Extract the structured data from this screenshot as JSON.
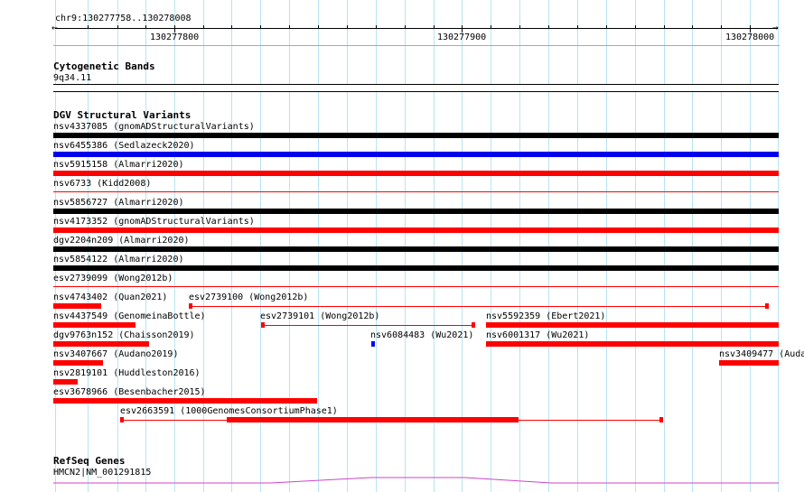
{
  "ruler": {
    "locus": "chr9:130277758..130278008",
    "left_arrow": "←",
    "right_arrow": "→",
    "tick_labels": [
      "130277800",
      "130277900",
      "130278000"
    ]
  },
  "cytoband": {
    "title": "Cytogenetic Bands",
    "band": "9q34.11"
  },
  "dgv": {
    "title": "DGV Structural Variants",
    "variants": [
      {
        "label": "nsv4337085 (gnomADStructuralVariants)",
        "color": "#000000"
      },
      {
        "label": "nsv6455386 (Sedlazeck2020)",
        "color": "#0000ee"
      },
      {
        "label": "nsv5915158 (Almarri2020)",
        "color": "#ff0000"
      },
      {
        "label": "nsv6733 (Kidd2008)",
        "color": "#ff0000"
      },
      {
        "label": "nsv5856727 (Almarri2020)",
        "color": "#000000"
      },
      {
        "label": "nsv4173352 (gnomADStructuralVariants)",
        "color": "#ff0000"
      },
      {
        "label": "dgv2204n209 (Almarri2020)",
        "color": "#000000"
      },
      {
        "label": "nsv5854122 (Almarri2020)",
        "color": "#000000"
      },
      {
        "label": "esv2739099 (Wong2012b)",
        "color": "#ff0000"
      },
      {
        "label": "nsv4743402 (Quan2021)",
        "color": "#ff0000"
      },
      {
        "label": "esv2739100 (Wong2012b)",
        "color": "#ff0000"
      },
      {
        "label": "nsv4437549 (GenomeinaBottle)",
        "color": "#ff0000"
      },
      {
        "label": "esv2739101 (Wong2012b)",
        "color": "#ff0000"
      },
      {
        "label": "nsv5592359 (Ebert2021)",
        "color": "#ff0000"
      },
      {
        "label": "dgv9763n152 (Chaisson2019)",
        "color": "#ff0000"
      },
      {
        "label": "nsv6084483 (Wu2021)",
        "color": "#0000ee"
      },
      {
        "label": "nsv6001317 (Wu2021)",
        "color": "#ff0000"
      },
      {
        "label": "nsv3407667 (Audano2019)",
        "color": "#ff0000"
      },
      {
        "label": "nsv3409477 (Auda",
        "color": "#ff0000"
      },
      {
        "label": "nsv2819101 (Huddleston2016)",
        "color": "#ff0000"
      },
      {
        "label": "esv3678966 (Besenbacher2015)",
        "color": "#ff0000"
      },
      {
        "label": "esv2663591 (1000GenomesConsortiumPhase1)",
        "color": "#ff0000"
      }
    ]
  },
  "refseq": {
    "title": "RefSeq Genes",
    "gene": "HMCN2|NM_001291815",
    "color": "#cc44cc"
  },
  "colors": {
    "grid": "#b8e4f2",
    "track_bg": "#ffffff"
  }
}
